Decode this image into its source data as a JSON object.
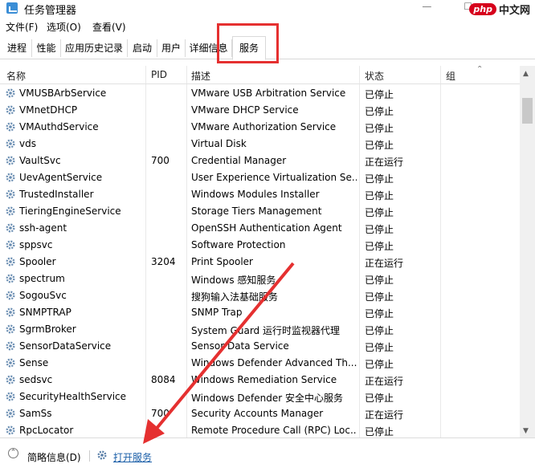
{
  "window": {
    "title": "任务管理器",
    "controls": "— ☐"
  },
  "watermark": {
    "badge": "php",
    "text": "中文网"
  },
  "menu": [
    "文件(F)",
    "选项(O)",
    "查看(V)"
  ],
  "tabs": [
    "进程",
    "性能",
    "应用历史记录",
    "启动",
    "用户",
    "详细信息",
    "服务"
  ],
  "active_tab": "服务",
  "columns": [
    "名称",
    "PID",
    "描述",
    "状态",
    "组"
  ],
  "rows": [
    {
      "name": "VMUSBArbService",
      "pid": "",
      "desc": "VMware USB Arbitration Service",
      "status": "已停止"
    },
    {
      "name": "VMnetDHCP",
      "pid": "",
      "desc": "VMware DHCP Service",
      "status": "已停止"
    },
    {
      "name": "VMAuthdService",
      "pid": "",
      "desc": "VMware Authorization Service",
      "status": "已停止"
    },
    {
      "name": "vds",
      "pid": "",
      "desc": "Virtual Disk",
      "status": "已停止"
    },
    {
      "name": "VaultSvc",
      "pid": "700",
      "desc": "Credential Manager",
      "status": "正在运行"
    },
    {
      "name": "UevAgentService",
      "pid": "",
      "desc": "User Experience Virtualization Se...",
      "status": "已停止"
    },
    {
      "name": "TrustedInstaller",
      "pid": "",
      "desc": "Windows Modules Installer",
      "status": "已停止"
    },
    {
      "name": "TieringEngineService",
      "pid": "",
      "desc": "Storage Tiers Management",
      "status": "已停止"
    },
    {
      "name": "ssh-agent",
      "pid": "",
      "desc": "OpenSSH Authentication Agent",
      "status": "已停止"
    },
    {
      "name": "sppsvc",
      "pid": "",
      "desc": "Software Protection",
      "status": "已停止"
    },
    {
      "name": "Spooler",
      "pid": "3204",
      "desc": "Print Spooler",
      "status": "正在运行"
    },
    {
      "name": "spectrum",
      "pid": "",
      "desc": "Windows 感知服务",
      "status": "已停止"
    },
    {
      "name": "SogouSvc",
      "pid": "",
      "desc": "搜狗输入法基础服务",
      "status": "已停止"
    },
    {
      "name": "SNMPTRAP",
      "pid": "",
      "desc": "SNMP Trap",
      "status": "已停止"
    },
    {
      "name": "SgrmBroker",
      "pid": "",
      "desc": "System Guard 运行时监视器代理",
      "status": "已停止"
    },
    {
      "name": "SensorDataService",
      "pid": "",
      "desc": "Sensor Data Service",
      "status": "已停止"
    },
    {
      "name": "Sense",
      "pid": "",
      "desc": "Windows Defender Advanced Th...",
      "status": "已停止"
    },
    {
      "name": "sedsvc",
      "pid": "8084",
      "desc": "Windows Remediation Service",
      "status": "正在运行"
    },
    {
      "name": "SecurityHealthService",
      "pid": "",
      "desc": "Windows Defender 安全中心服务",
      "status": "已停止"
    },
    {
      "name": "SamSs",
      "pid": "700",
      "desc": "Security Accounts Manager",
      "status": "正在运行"
    },
    {
      "name": "RpcLocator",
      "pid": "",
      "desc": "Remote Procedure Call (RPC) Loc...",
      "status": "已停止"
    }
  ],
  "status_bar": {
    "less_details": "简略信息(D)",
    "open_services": "打开服务"
  },
  "colors": {
    "highlight": "#e53030",
    "link": "#1a5ea8"
  }
}
